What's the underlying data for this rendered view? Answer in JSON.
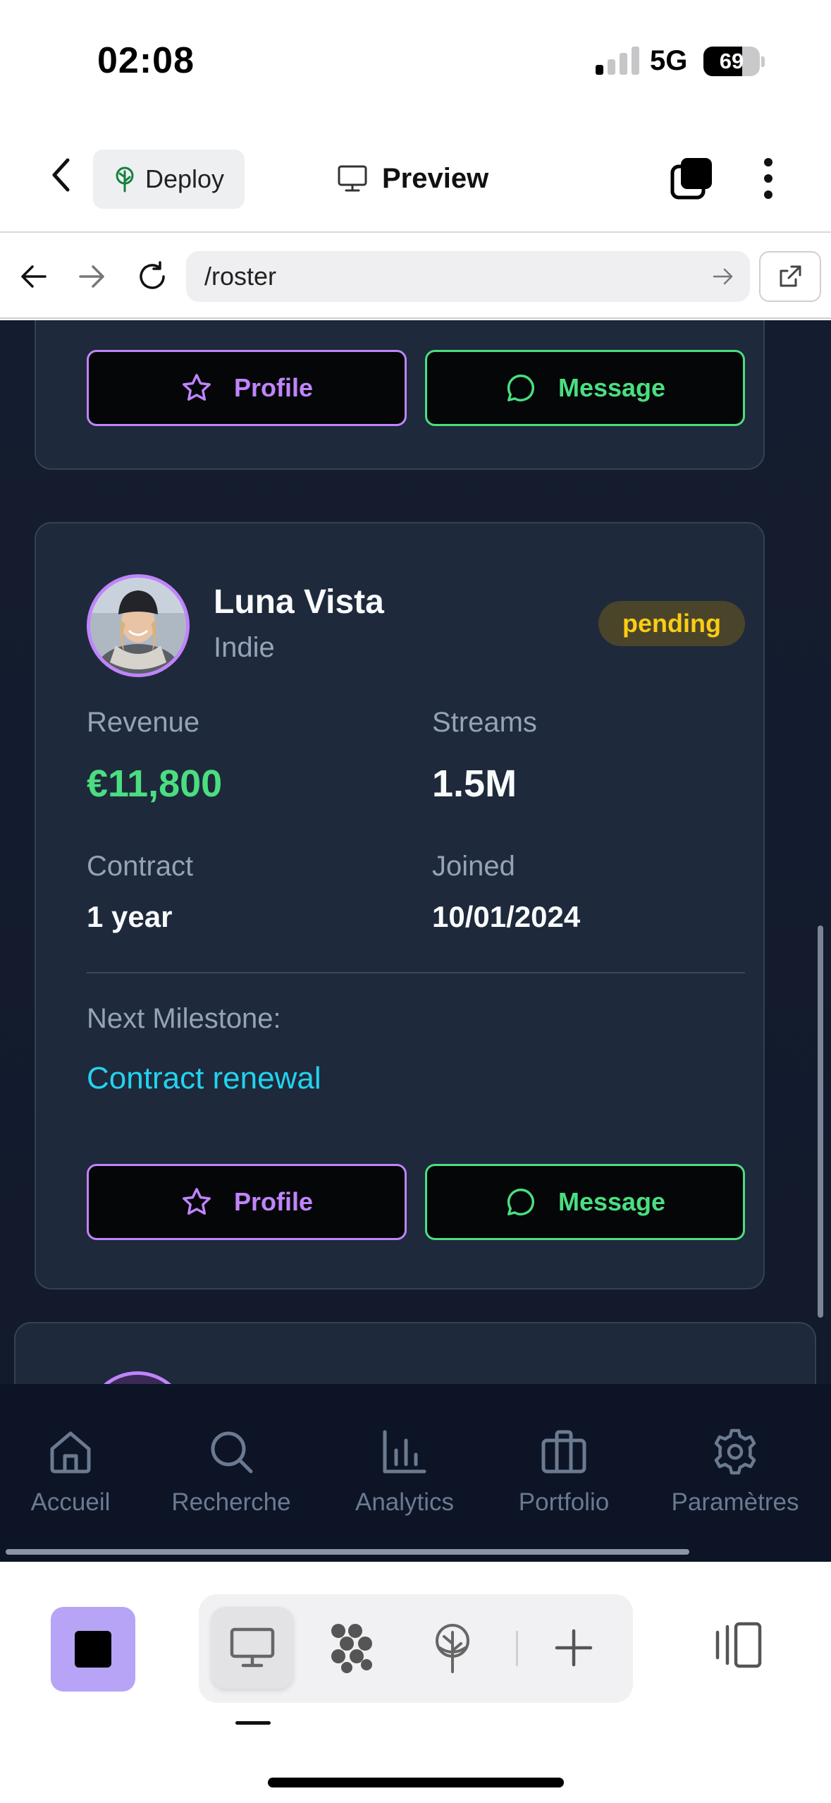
{
  "status_bar": {
    "time": "02:08",
    "network": "5G",
    "battery_level": "69",
    "battery_fraction": 0.69,
    "signal_bars_active": 1,
    "signal_bars_total": 4
  },
  "header": {
    "deploy_label": "Deploy",
    "preview_label": "Preview"
  },
  "browser": {
    "url": "/roster"
  },
  "previous_card": {
    "profile_label": "Profile",
    "message_label": "Message"
  },
  "artist_card": {
    "name": "Luna Vista",
    "type": "Indie",
    "status": "pending",
    "revenue_label": "Revenue",
    "revenue_value": "€11,800",
    "streams_label": "Streams",
    "streams_value": "1.5M",
    "contract_label": "Contract",
    "contract_value": "1 year",
    "joined_label": "Joined",
    "joined_value": "10/01/2024",
    "milestone_label": "Next Milestone:",
    "milestone_value": "Contract renewal",
    "profile_label": "Profile",
    "message_label": "Message"
  },
  "bottom_nav": {
    "items": [
      {
        "label": "Accueil",
        "icon": "home-icon"
      },
      {
        "label": "Recherche",
        "icon": "search-icon"
      },
      {
        "label": "Analytics",
        "icon": "bar-chart-icon"
      },
      {
        "label": "Portfolio",
        "icon": "briefcase-icon"
      },
      {
        "label": "Paramètres",
        "icon": "gear-icon"
      }
    ]
  },
  "colors": {
    "profile_accent": "#c084fc",
    "message_accent": "#4ade80",
    "pending_badge_text": "#facc15",
    "milestone_text": "#22d3ee",
    "card_background": "#1e293b",
    "page_background": "#141c2f"
  }
}
